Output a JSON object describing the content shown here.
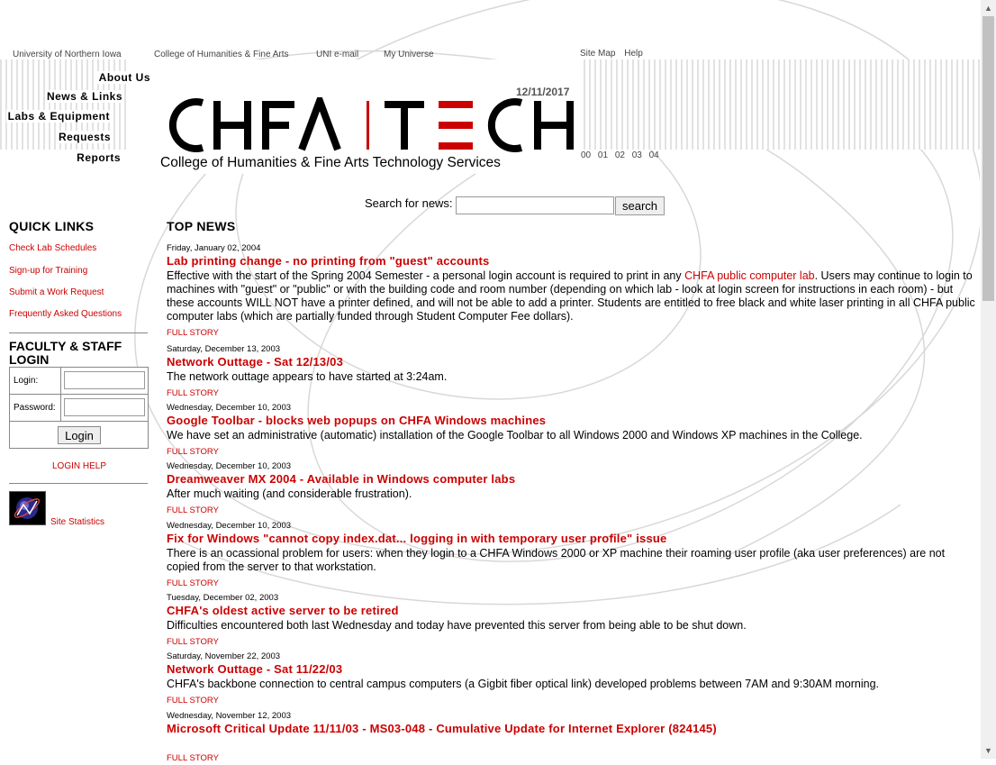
{
  "top_links": [
    "University of Northern Iowa",
    "College of Humanities & Fine Arts",
    "UNI e-mail",
    "My Universe"
  ],
  "site_links": [
    "Site Map",
    "Help"
  ],
  "nav": [
    "About Us",
    "News & Links",
    "Labs & Equipment",
    "Requests",
    "Reports"
  ],
  "date": "12/11/2017",
  "logo": {
    "left": "CHFA",
    "right": "TECH"
  },
  "tagline": "College of Humanities & Fine Arts Technology Services",
  "issues": [
    "00",
    "01",
    "02",
    "03",
    "04"
  ],
  "search": {
    "label": "Search for news:",
    "value": "",
    "button": "search"
  },
  "quick_links": {
    "title": "QUICK LINKS",
    "items": [
      "Check Lab Schedules",
      "Sign-up for Training",
      "Submit a Work Request",
      "Frequently Asked Questions"
    ]
  },
  "login": {
    "title": "FACULTY & STAFF LOGIN",
    "login_label": "Login:",
    "password_label": "Password:",
    "login_value": "",
    "password_value": "",
    "button": "Login",
    "help": "LOGIN HELP"
  },
  "site_statistics": "Site Statistics",
  "top_news_title": "TOP NEWS",
  "full_story": "FULL STORY",
  "news": [
    {
      "date": "Friday, January 02, 2004",
      "title": "Lab printing change - no printing from \"guest\" accounts",
      "body_pre": "Effective with the start of the Spring 2004 Semester - a personal login account is required to print in any ",
      "body_link": "CHFA public computer lab",
      "body_post": ". Users may continue to login to machines with \"guest\" or \"public\" or with the building code and room number (depending on which lab - look at login screen for instructions in each room) - but these accounts WILL NOT have a printer defined, and will not be able to add a printer. Students are entitled to free black and white laser printing in all CHFA public computer labs (which are partially funded through Student Computer Fee dollars)."
    },
    {
      "date": "Saturday, December 13, 2003",
      "title": "Network Outtage - Sat 12/13/03",
      "body": "The network outtage appears to have started at 3:24am."
    },
    {
      "date": "Wednesday, December 10, 2003",
      "title": "Google Toolbar - blocks web popups on CHFA Windows machines",
      "body": "We have set an administrative (automatic) installation of the Google Toolbar to all Windows 2000 and Windows XP machines in the College."
    },
    {
      "date": "Wednesday, December 10, 2003",
      "title": "Dreamweaver MX 2004 - Available in Windows computer labs",
      "body": "After much waiting (and considerable frustration)."
    },
    {
      "date": "Wednesday, December 10, 2003",
      "title": "Fix for Windows \"cannot copy index.dat... logging in with temporary user profile\" issue",
      "body": "There is an ocassional problem for users: when they login to a CHFA Windows 2000 or XP machine their roaming user profile (aka user preferences) are not copied from the server to that workstation."
    },
    {
      "date": "Tuesday, December 02, 2003",
      "title": "CHFA's oldest active server to be retired",
      "body": "Difficulties encountered both last Wednesday and today have prevented this server from being able to be shut down."
    },
    {
      "date": "Saturday, November 22, 2003",
      "title": "Network Outtage - Sat 11/22/03",
      "body": "CHFA's backbone connection to central campus computers (a Gigbit fiber optical link) developed problems between 7AM and 9:30AM morning."
    },
    {
      "date": "Wednesday, November 12, 2003",
      "title": "Microsoft Critical Update 11/11/03 - MS03-048 - Cumulative Update for Internet Explorer (824145)",
      "body": ""
    }
  ],
  "colors": {
    "accent": "#cc0000",
    "stripe": "#e2e2e2"
  }
}
